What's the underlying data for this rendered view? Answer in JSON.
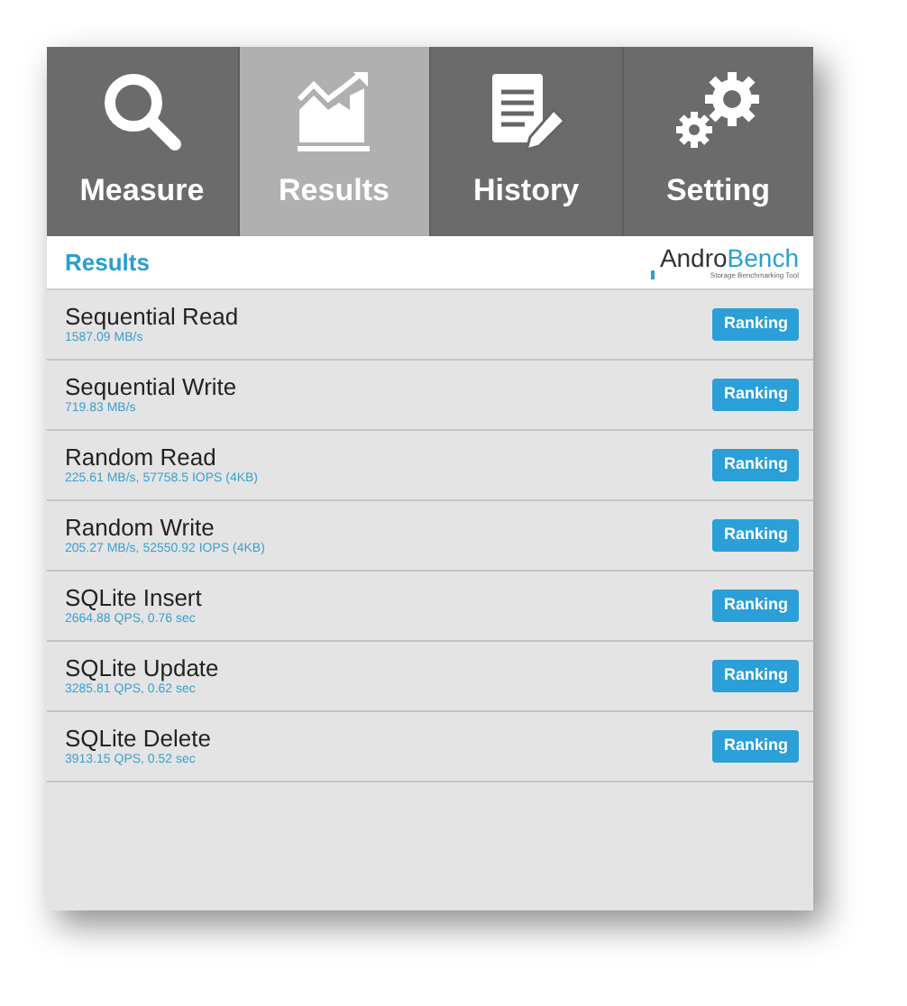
{
  "tabs": [
    {
      "kind": "measure",
      "label": "Measure",
      "selected": false
    },
    {
      "kind": "results",
      "label": "Results",
      "selected": true
    },
    {
      "kind": "history",
      "label": "History",
      "selected": false
    },
    {
      "kind": "setting",
      "label": "Setting",
      "selected": false
    }
  ],
  "header": {
    "title": "Results",
    "logo": {
      "part_1": "Andro",
      "part_2": "Bench",
      "tagline": "Storage Benchmarking Tool"
    }
  },
  "results": [
    {
      "name": "Sequential Read",
      "value": "1587.09 MB/s",
      "button": "Ranking"
    },
    {
      "name": "Sequential Write",
      "value": "719.83 MB/s",
      "button": "Ranking"
    },
    {
      "name": "Random Read",
      "value": "225.61 MB/s, 57758.5 IOPS (4KB)",
      "button": "Ranking"
    },
    {
      "name": "Random Write",
      "value": "205.27 MB/s, 52550.92 IOPS (4KB)",
      "button": "Ranking"
    },
    {
      "name": "SQLite Insert",
      "value": "2664.88 QPS, 0.76 sec",
      "button": "Ranking"
    },
    {
      "name": "SQLite Update",
      "value": "3285.81 QPS, 0.62 sec",
      "button": "Ranking"
    },
    {
      "name": "SQLite Delete",
      "value": "3913.15 QPS, 0.52 sec",
      "button": "Ranking"
    }
  ]
}
